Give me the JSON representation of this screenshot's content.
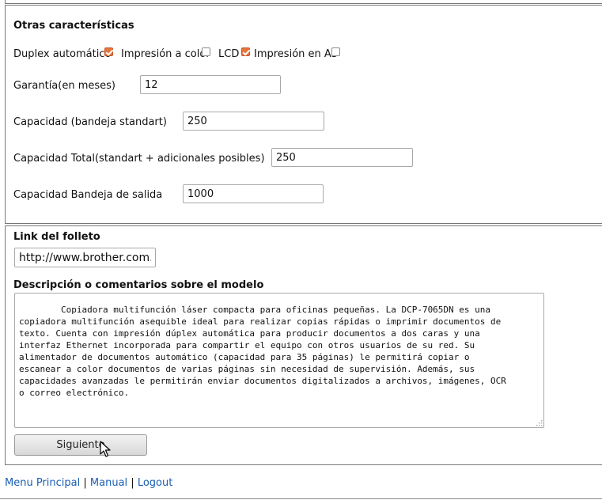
{
  "features": {
    "heading": "Otras características",
    "options": [
      {
        "label": "Duplex automático",
        "checked": true
      },
      {
        "label": "Impresión a color",
        "checked": false
      },
      {
        "label": "LCD",
        "checked": true
      },
      {
        "label": "Impresión en A3",
        "checked": false
      }
    ]
  },
  "fields": {
    "warranty": {
      "label": "Garantía(en meses)",
      "value": "12"
    },
    "capacity_standard": {
      "label": "Capacidad (bandeja standart)",
      "value": "250"
    },
    "capacity_total": {
      "label": "Capacidad Total(standart + adicionales posibles)",
      "value": "250"
    },
    "capacity_output": {
      "label": "Capacidad Bandeja de salida",
      "value": "1000"
    }
  },
  "brochure": {
    "label": "Link del folleto",
    "value": "http://www.brother.com."
  },
  "description": {
    "label": "Descripción o comentarios sobre el modelo",
    "value": "        Copiadora multifunción láser compacta para oficinas pequeñas. La DCP-7065DN es una\ncopiadora multifunción asequible ideal para realizar copias rápidas o imprimir documentos de\ntexto. Cuenta con impresión dúplex automática para producir documentos a dos caras y una\ninterfaz Ethernet incorporada para compartir el equipo con otros usuarios de su red. Su\nalimentador de documentos automático (capacidad para 35 páginas) le permitirá copiar o\nescanear a color documentos de varias páginas sin necesidad de supervisión. Además, sus\ncapacidades avanzadas le permitirán enviar documentos digitalizados a archivos, imágenes, OCR\no correo electrónico."
  },
  "actions": {
    "next_label": "Siguiente"
  },
  "footer": {
    "links": [
      "Menu Principal",
      "Manual",
      "Logout"
    ],
    "separator": "|"
  },
  "colors": {
    "link": "#1a5fb4",
    "checkbox_checked": "#e8753a"
  }
}
